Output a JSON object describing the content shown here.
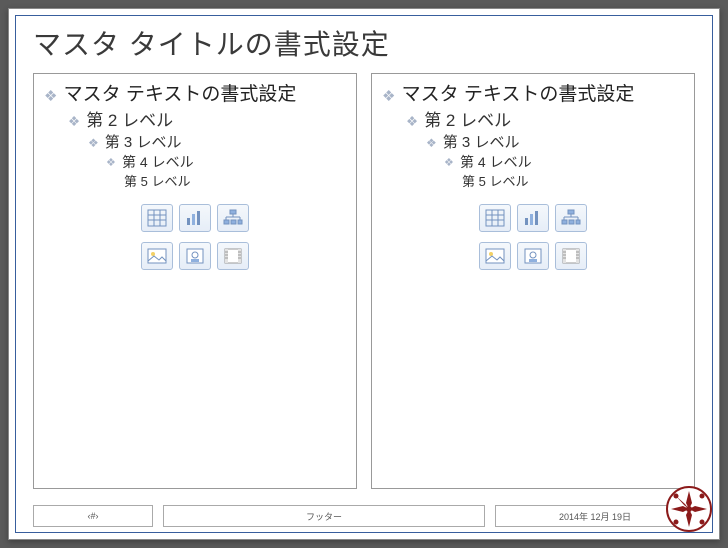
{
  "title": "マスタ タイトルの書式設定",
  "levels": {
    "l1": "マスタ テキストの書式設定",
    "l2": "第 2 レベル",
    "l3": "第 3 レベル",
    "l4": "第 4 レベル",
    "l5": "第 5 レベル"
  },
  "footer": {
    "page": "‹#›",
    "text": "フッター",
    "date": "2014年 12月 19日"
  },
  "icons": [
    "table",
    "chart",
    "smartart",
    "picture",
    "clipart",
    "media"
  ]
}
